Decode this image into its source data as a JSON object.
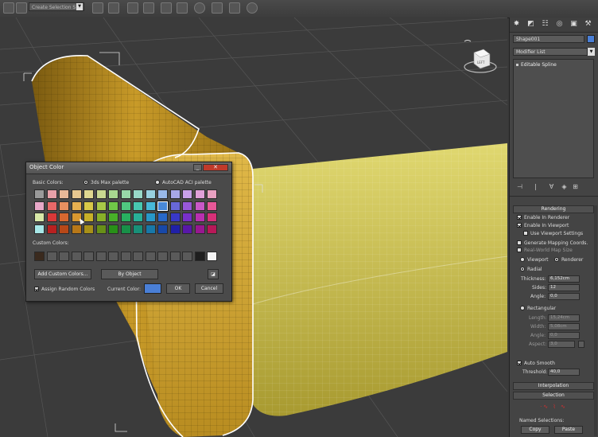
{
  "toolbar": {
    "selection_set_placeholder": "Create Selection S",
    "icons": [
      "select-icon",
      "mirror-icon",
      "align-icon",
      "layer-icon",
      "ribbon-icon",
      "curve-editor-icon",
      "schematic-icon",
      "material-editor-icon",
      "render-setup-icon",
      "rendered-frame-icon",
      "render-icon"
    ]
  },
  "viewport": {
    "viewcube_label": "LEFT"
  },
  "command_panel": {
    "tabs": [
      "create-tab",
      "modify-tab",
      "hierarchy-tab",
      "motion-tab",
      "display-tab",
      "utilities-tab"
    ],
    "object_name": "Shape001",
    "object_color_hex": "#4a7fd6",
    "modifier_list_label": "Modifier List",
    "stack_item": "Editable Spline",
    "rendering": {
      "header": "Rendering",
      "enable_in_renderer": "Enable In Renderer",
      "enable_in_viewport": "Enable In Viewport",
      "use_viewport_settings": "Use Viewport Settings",
      "generate_mapping": "Generate Mapping Coords.",
      "real_world_map": "Real-World Map Size",
      "viewport_label": "Viewport",
      "renderer_label": "Renderer",
      "radial_label": "Radial",
      "thickness_label": "Thickness:",
      "thickness_value": "6,152cm",
      "sides_label": "Sides:",
      "sides_value": "12",
      "angle_label": "Angle:",
      "angle_value": "0,0",
      "rectangular_label": "Rectangular",
      "length_label": "Length:",
      "length_value": "15,24cm",
      "width_label": "Width:",
      "width_value": "5,08cm",
      "rect_angle_label": "Angle:",
      "rect_angle_value": "0,0",
      "aspect_label": "Aspect:",
      "aspect_value": "3,0",
      "auto_smooth_label": "Auto Smooth",
      "threshold_label": "Threshold:",
      "threshold_value": "40,0"
    },
    "interpolation_header": "Interpolation",
    "selection_header": "Selection",
    "named_selections_label": "Named Selections:",
    "copy_label": "Copy",
    "paste_label": "Paste"
  },
  "dialog": {
    "title": "Object Color",
    "basic_colors_label": "Basic Colors:",
    "max_palette_label": "3ds Max palette",
    "autocad_palette_label": "AutoCAD ACI palette",
    "custom_colors_label": "Custom Colors:",
    "add_custom_label": "Add Custom Colors...",
    "by_object_label": "By Object",
    "assign_random_label": "Assign Random Colors",
    "current_color_label": "Current Color:",
    "current_color_hex": "#4a7fd6",
    "ok_label": "OK",
    "cancel_label": "Cancel",
    "basic_palette": [
      [
        "#9a9a9a",
        "#e8a0a8",
        "#e8b898",
        "#e8c890",
        "#e0d890",
        "#c8d890",
        "#a8d890",
        "#98d8a8",
        "#98d8c8",
        "#98d0e0",
        "#98b8e8",
        "#a8a8e8",
        "#c8a0e8",
        "#e0a0d8",
        "#e8a0c0"
      ],
      [
        "#e8a8c8",
        "#e86868",
        "#e89060",
        "#e8b050",
        "#d8c848",
        "#a8c848",
        "#70c848",
        "#50c880",
        "#48c8b0",
        "#48b8d8",
        "#4888d8",
        "#6868d8",
        "#9858d8",
        "#c858c8",
        "#e85898"
      ],
      [
        "#d8e8a8",
        "#d83838",
        "#d86830",
        "#d89830",
        "#c8b028",
        "#88b028",
        "#48b028",
        "#28b060",
        "#28b098",
        "#2898c8",
        "#2868c8",
        "#3838c8",
        "#7830c8",
        "#b830b0",
        "#d83078"
      ],
      [
        "#a8e8e8",
        "#b82020",
        "#b84818",
        "#b87818",
        "#a89018",
        "#689018",
        "#289018",
        "#189048",
        "#189078",
        "#1878a8",
        "#1848a8",
        "#2020a8",
        "#5818a8",
        "#981890",
        "#b81858"
      ]
    ],
    "custom_palette": [
      "#3a2a1e",
      "#5a5a5a",
      "#5a5a5a",
      "#5a5a5a",
      "#5a5a5a",
      "#5a5a5a",
      "#5a5a5a",
      "#5a5a5a",
      "#5a5a5a",
      "#5a5a5a",
      "#5a5a5a",
      "#5a5a5a",
      "#5a5a5a",
      "#1e1e1e",
      "#f4f4f4"
    ]
  }
}
